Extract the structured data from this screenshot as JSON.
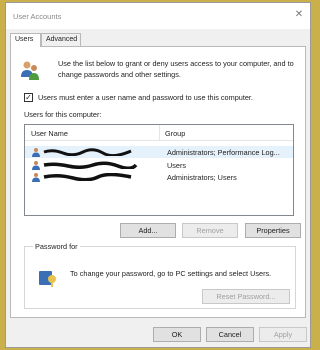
{
  "window": {
    "title": "User Accounts",
    "close_glyph": "✕"
  },
  "tabs": [
    {
      "label": "Users"
    },
    {
      "label": "Advanced"
    }
  ],
  "intro_text": "Use the list below to grant or deny users access to your computer, and to change passwords and other settings.",
  "require_login": {
    "label": "Users must enter a user name and password to use this computer.",
    "checked": true
  },
  "users_for_computer_label": "Users for this computer:",
  "table": {
    "columns": [
      "User Name",
      "Group"
    ],
    "rows": [
      {
        "group": "Administrators; Performance Log...",
        "selected": true
      },
      {
        "group": "Users",
        "selected": false
      },
      {
        "group": "Administrators; Users",
        "selected": false
      }
    ]
  },
  "buttons": {
    "add": "Add...",
    "remove": "Remove",
    "properties": "Properties",
    "reset_password": "Reset Password...",
    "ok": "OK",
    "cancel": "Cancel",
    "apply": "Apply"
  },
  "password_group": {
    "label": "Password for",
    "text": "To change your password, go to PC settings and select Users."
  },
  "icons": {
    "users": "users-icon",
    "user_row": "user-icon",
    "password": "password-icon",
    "close": "close-icon"
  }
}
